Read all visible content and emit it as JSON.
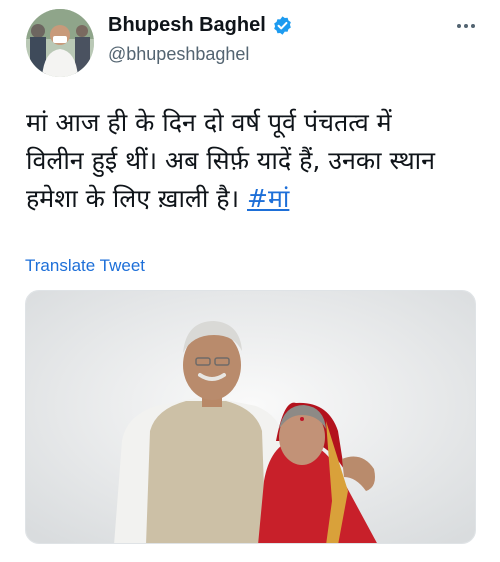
{
  "author": {
    "display_name": "Bhupesh Baghel",
    "handle": "@bhupeshbaghel"
  },
  "icons": {
    "verified": "verified-badge-icon",
    "more": "more-options-icon"
  },
  "tweet": {
    "lines": [
      "मां आज ही के दिन दो वर्ष पूर्व पंचतत्व में",
      "विलीन हुई थीं। अब सिर्फ़ यादें हैं, उनका स्थान"
    ],
    "line3_prefix": "हमेशा के लिए ख़ाली है। ",
    "hashtag": "#मां"
  },
  "translate_label": "Translate Tweet",
  "colors": {
    "link": "#1d6fd8",
    "verified": "#1d9bf0",
    "secondary_text": "#536471"
  }
}
